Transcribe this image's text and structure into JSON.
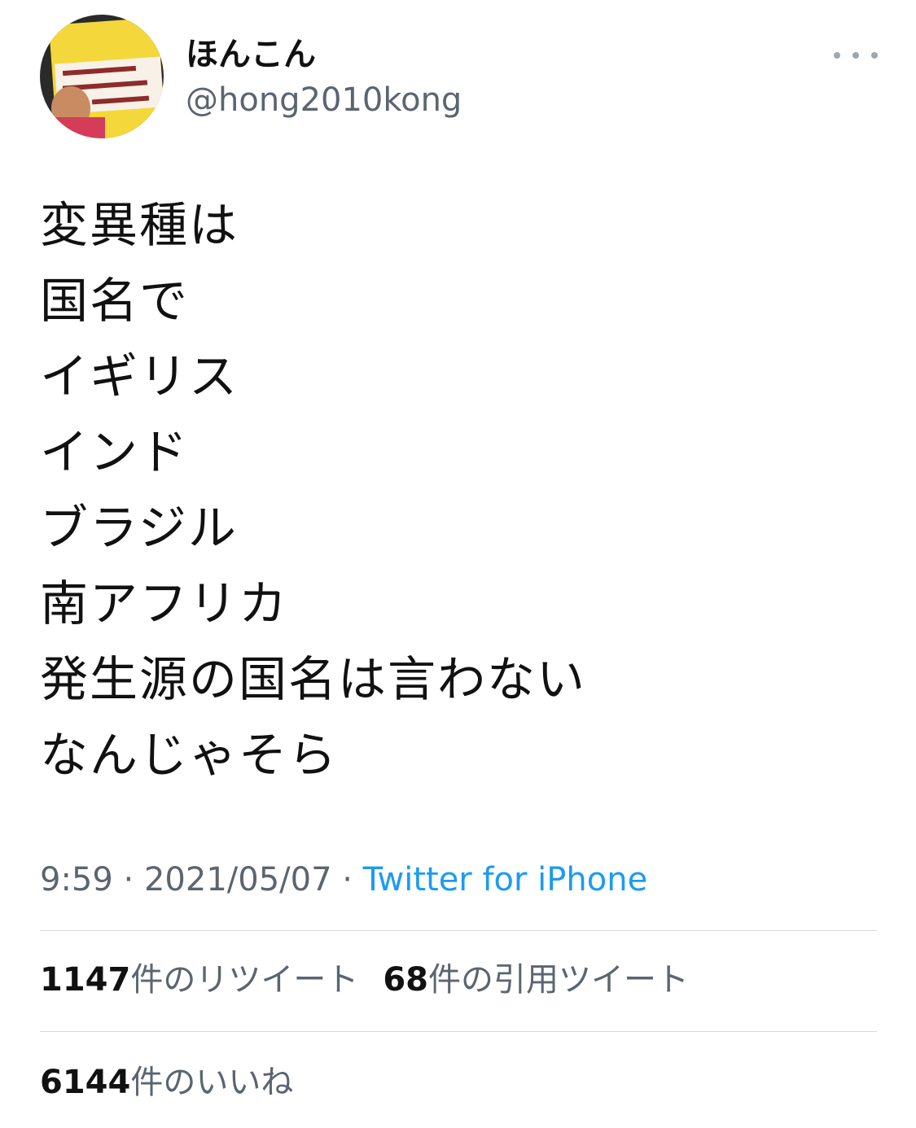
{
  "user": {
    "display_name": "ほんこん",
    "handle": "@hong2010kong"
  },
  "tweet": {
    "lines": [
      "変異種は",
      "国名で",
      "イギリス",
      "インド",
      "ブラジル",
      "南アフリカ",
      "発生源の国名は言わない",
      "なんじゃそら"
    ],
    "time": "9:59",
    "separator": " · ",
    "date": "2021/05/07",
    "source": "Twitter for iPhone"
  },
  "stats": {
    "retweets": {
      "count": "1147",
      "label": "件のリツイート"
    },
    "quotes": {
      "count": "68",
      "label": "件の引用ツイート"
    },
    "likes": {
      "count": "6144",
      "label": "件のいいね"
    }
  },
  "icons": {
    "more": "more-horizontal-icon",
    "avatar": "profile-photo"
  },
  "colors": {
    "link": "#1d9bf0",
    "secondary_text": "#5b6570",
    "divider": "#d7dbdf"
  }
}
